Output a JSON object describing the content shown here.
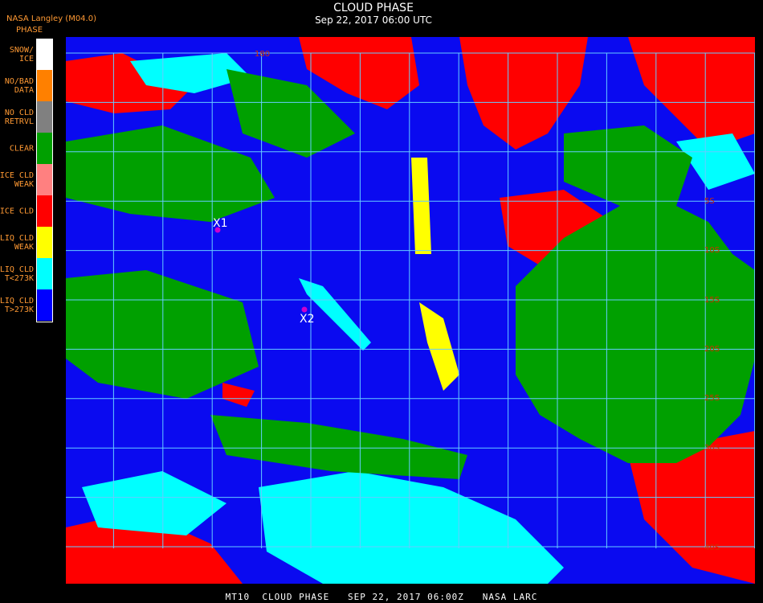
{
  "header": {
    "title": "CLOUD PHASE",
    "subtitle": "Sep 22, 2017 06:00 UTC",
    "producer": "NASA Langley (M04.0)",
    "legend_title": "PHASE"
  },
  "legend": [
    {
      "label": "SNOW/\nICE",
      "color": "#ffffff"
    },
    {
      "label": "NO/BAD\nDATA",
      "color": "#ff8000"
    },
    {
      "label": "NO CLD\nRETRVL",
      "color": "#808080"
    },
    {
      "label": "CLEAR",
      "color": "#00a000"
    },
    {
      "label": "ICE CLD\nWEAK",
      "color": "#ff8080"
    },
    {
      "label": "ICE CLD",
      "color": "#ff0000"
    },
    {
      "label": "LIQ CLD\nWEAK",
      "color": "#ffff00"
    },
    {
      "label": "LIQ CLD\nT<273K",
      "color": "#00ffff"
    },
    {
      "label": "LIQ CLD\nT>273K",
      "color": "#0000ff"
    }
  ],
  "markers": [
    {
      "label": "X1"
    },
    {
      "label": "X2"
    }
  ],
  "grid_labels": [
    "180",
    "5S",
    "10S",
    "15S",
    "20S",
    "25S",
    "30S",
    "40S"
  ],
  "footer": "MT10  CLOUD PHASE   SEP 22, 2017 06:00Z   NASA LARC",
  "colors": {
    "grid": "#66ccff",
    "marker": "#cc00cc",
    "grid_label": "#cc3300"
  }
}
